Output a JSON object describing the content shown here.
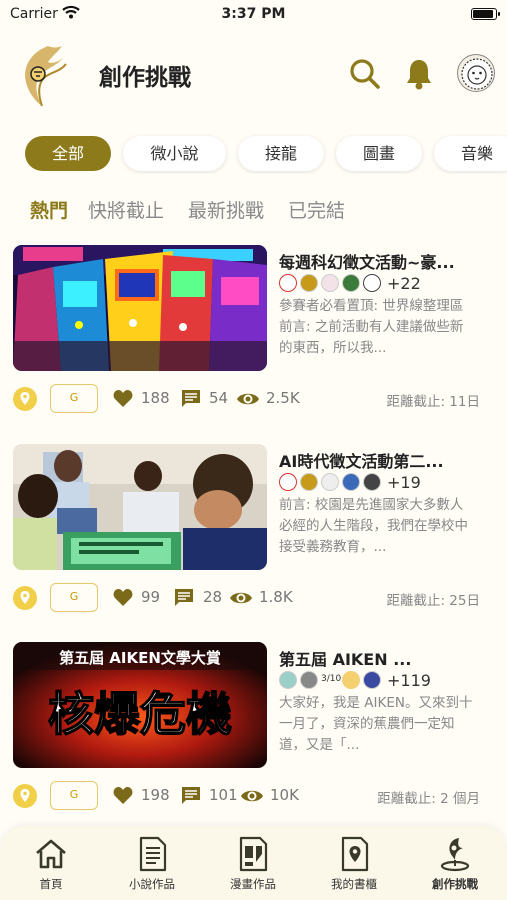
{
  "status_bar": {
    "carrier": "Carrier",
    "time": "3:37 PM"
  },
  "header": {
    "title": "創作挑戰",
    "icons": [
      "logo",
      "search-icon",
      "bell-icon",
      "avatar"
    ]
  },
  "categories": [
    {
      "label": "全部",
      "active": true
    },
    {
      "label": "微小說",
      "active": false
    },
    {
      "label": "接龍",
      "active": false
    },
    {
      "label": "圖畫",
      "active": false
    },
    {
      "label": "音樂",
      "active": false
    }
  ],
  "subtabs": [
    {
      "label": "熱門",
      "active": true
    },
    {
      "label": "快將截止",
      "active": false
    },
    {
      "label": "最新挑戰",
      "active": false
    },
    {
      "label": "已完結",
      "active": false
    }
  ],
  "cards": [
    {
      "title": "每週科幻徵文活動~豪...",
      "participants_more": "+22",
      "description": "參賽者必看置頂: 世界線整理區前言: 之前活動有人建議做些新的東西，所以我...",
      "rating": "G",
      "likes": "188",
      "comments": "54",
      "views": "2.5K",
      "deadline": "距離截止: 11日"
    },
    {
      "title": "AI時代徵文活動第二...",
      "participants_more": "+19",
      "description": "前言: 校園是先進國家大多數人必經的人生階段，我們在學校中接受義務教育，...",
      "rating": "G",
      "likes": "99",
      "comments": "28",
      "views": "1.8K",
      "deadline": "距離截止: 25日"
    },
    {
      "title": "第五屆 AIKEN ...",
      "participants_more": "+119",
      "avatar_text": "3/10",
      "description": "大家好，我是 AIKEN。又來到十一月了，資深的蕉農們一定知道，又是「...",
      "rating": "G",
      "likes": "198",
      "comments": "101",
      "views": "10K",
      "deadline": "距離截止: 2 個月",
      "banner_top": "第五屆 AIKEN文學大賞",
      "banner_main": "核爆危機"
    }
  ],
  "tabbar": [
    {
      "label": "首頁",
      "icon": "home-icon"
    },
    {
      "label": "小說作品",
      "icon": "novel-icon"
    },
    {
      "label": "漫畫作品",
      "icon": "comic-icon"
    },
    {
      "label": "我的書櫃",
      "icon": "bookshelf-icon"
    },
    {
      "label": "創作挑戰",
      "icon": "challenge-icon",
      "active": true
    }
  ],
  "colors": {
    "accent": "#8c7a1b",
    "background": "#fffdf6",
    "badge": "#f1cf48"
  }
}
